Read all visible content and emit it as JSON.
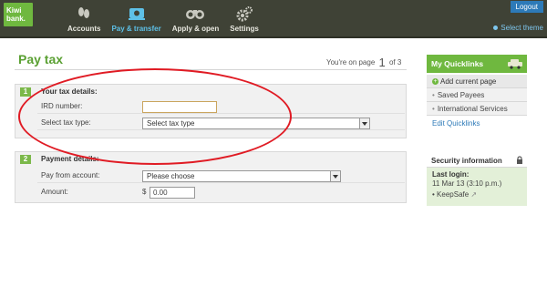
{
  "header": {
    "logo_line1": "Kiwi",
    "logo_line2": "bank.",
    "logout": "Logout",
    "select_theme": "Select theme",
    "nav": [
      {
        "label": "Accounts",
        "icon": "footprints-icon"
      },
      {
        "label": "Pay & transfer",
        "icon": "payments-icon"
      },
      {
        "label": "Apply & open",
        "icon": "binoculars-icon"
      },
      {
        "label": "Settings",
        "icon": "gears-icon"
      }
    ],
    "active_nav": "Pay & transfer",
    "colors": {
      "bar": "#3f4236",
      "accent": "#6fb83f",
      "active": "#5ec1e8"
    }
  },
  "main": {
    "title": "Pay tax",
    "page_prefix": "You're on page",
    "page_current": "1",
    "page_suffix": "of 3",
    "section1": {
      "number": "1",
      "heading": "Your tax details:",
      "ird_label": "IRD number:",
      "ird_value": "",
      "tax_type_label": "Select tax type:",
      "tax_type_value": "Select tax type"
    },
    "section2": {
      "number": "2",
      "heading": "Payment details:",
      "from_label": "Pay from account:",
      "from_value": "Please choose",
      "amount_label": "Amount:",
      "currency": "$",
      "amount_value": "0.00"
    }
  },
  "sidebar": {
    "quicklinks_title": "My Quicklinks",
    "items": [
      {
        "label": "Add current page"
      },
      {
        "label": "Saved Payees"
      },
      {
        "label": "International Services"
      }
    ],
    "edit_label": "Edit Quicklinks",
    "security_title": "Security information",
    "last_login_label": "Last login:",
    "last_login_value": "11 Mar 13 (3:10 p.m.)",
    "keepsafe": "KeepSafe"
  },
  "annotation": {
    "color": "#e01b24"
  }
}
